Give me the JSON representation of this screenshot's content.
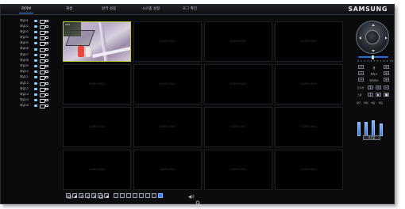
{
  "header": {
    "tabs": [
      {
        "label": "라이브",
        "active": true
      },
      {
        "label": "재생",
        "active": false
      },
      {
        "label": "원격 설정",
        "active": false
      },
      {
        "label": "시스템 설정",
        "active": false
      },
      {
        "label": "로그 확인",
        "active": false
      }
    ],
    "brand": "SAMSUNG"
  },
  "cameras": [
    {
      "label": "채널01"
    },
    {
      "label": "채널02"
    },
    {
      "label": "채널03"
    },
    {
      "label": "채널04"
    },
    {
      "label": "채널05"
    },
    {
      "label": "채널06"
    },
    {
      "label": "채널07"
    },
    {
      "label": "채널08"
    },
    {
      "label": "채널09"
    },
    {
      "label": "채널10"
    },
    {
      "label": "채널11"
    },
    {
      "label": "채널12"
    },
    {
      "label": "채널13"
    },
    {
      "label": "채널14"
    },
    {
      "label": "채널15"
    },
    {
      "label": "채널16"
    }
  ],
  "grid": {
    "rows": 4,
    "cols": 4,
    "placeholder": "SAMSUNG",
    "active_channel_osd": "CH1"
  },
  "ptz": {
    "presets": "0 1 2 3 4 5 6 7 8 9 10",
    "zoom_label": "줌",
    "focus_label": "포커스",
    "iris_label": "아이리스",
    "preset_label": "프리셋",
    "swing_label": "스윙",
    "bar_labels": [
      "밝기",
      "대비",
      "색상",
      "채도"
    ],
    "bar_levels": [
      0.55,
      0.55,
      0.6,
      0.45
    ],
    "default_button": "초기값"
  },
  "colors": {
    "accent": "#2f7fff",
    "selected_border": "#b6d13a",
    "background": "#0b0b0e"
  },
  "toolbar": {
    "layout_buttons": [
      "1",
      "4",
      "9",
      "16"
    ],
    "icons": [
      "capture-icon",
      "record-icon",
      "rotate-icon",
      "refresh-icon",
      "fullscreen-icon",
      "audio-icon",
      "zoom-icon"
    ]
  }
}
